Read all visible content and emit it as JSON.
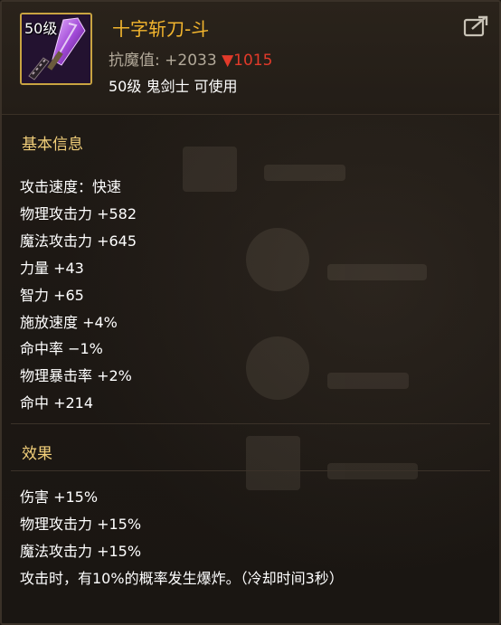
{
  "item": {
    "name": "十字斩刀-斗",
    "level_badge": "50级",
    "stat_label": "抗魔值:",
    "stat_value": "+2033",
    "stat_diff": "1015",
    "requirement": "50级 鬼剑士 可使用"
  },
  "basic_info": {
    "title": "基本信息",
    "lines": [
      "攻击速度：快速",
      "物理攻击力 +582",
      "魔法攻击力 +645",
      "力量 +43",
      "智力 +65",
      "施放速度 +4%",
      "命中率 −1%",
      "物理暴击率 +2%",
      "命中 +214"
    ]
  },
  "effects": {
    "title": "效果",
    "lines": [
      "伤害 +15%",
      "物理攻击力 +15%",
      "魔法攻击力 +15%",
      "攻击时，有10%的概率发生爆炸。（冷却时间3秒）"
    ]
  },
  "icons": {
    "item_icon": "purple-blade-weapon-icon",
    "share": "share-icon",
    "decrease": "red-down-triangle-icon"
  },
  "colors": {
    "item_name": "#f2b52e",
    "section_title": "#f2cf7a",
    "decrease": "#e23a2a",
    "frame": "#c9a441"
  }
}
